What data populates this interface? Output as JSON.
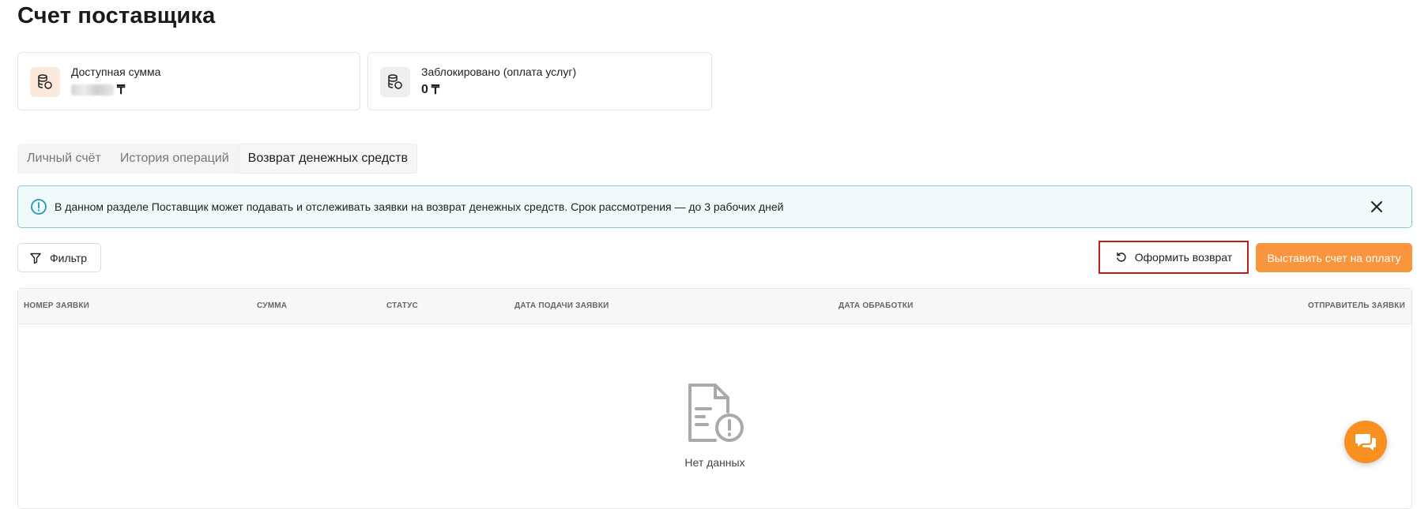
{
  "page": {
    "title": "Счет поставщика"
  },
  "balance_cards": [
    {
      "label": "Доступная сумма",
      "value": "",
      "currency": "₸",
      "icon": "coins-stack-icon"
    },
    {
      "label": "Заблокировано (оплата услуг)",
      "value": "0",
      "currency": "₸",
      "icon": "coins-stack-icon"
    }
  ],
  "tabs": [
    {
      "label": "Личный счёт",
      "active": false
    },
    {
      "label": "История операций",
      "active": false
    },
    {
      "label": "Возврат денежных средств",
      "active": true
    }
  ],
  "info_banner": {
    "text": "В данном разделе Поставщик может подавать и отслеживать заявки на возврат денежных средств. Срок рассмотрения — до 3 рабочих дней",
    "icon": "info-circle-icon"
  },
  "toolbar": {
    "filter_label": "Фильтр",
    "return_label": "Оформить возврат",
    "invoice_label": "Выставить счет на оплату"
  },
  "table": {
    "columns": [
      "Номер заявки",
      "Сумма",
      "Статус",
      "Дата подачи заявки",
      "Дата обработки",
      "Отправитель заявки"
    ],
    "empty_text": "Нет данных"
  },
  "colors": {
    "accent": "#f9953c",
    "highlight_border": "#c01d1d",
    "info_border": "#7fcad6",
    "info_bg": "#f0fafc"
  }
}
